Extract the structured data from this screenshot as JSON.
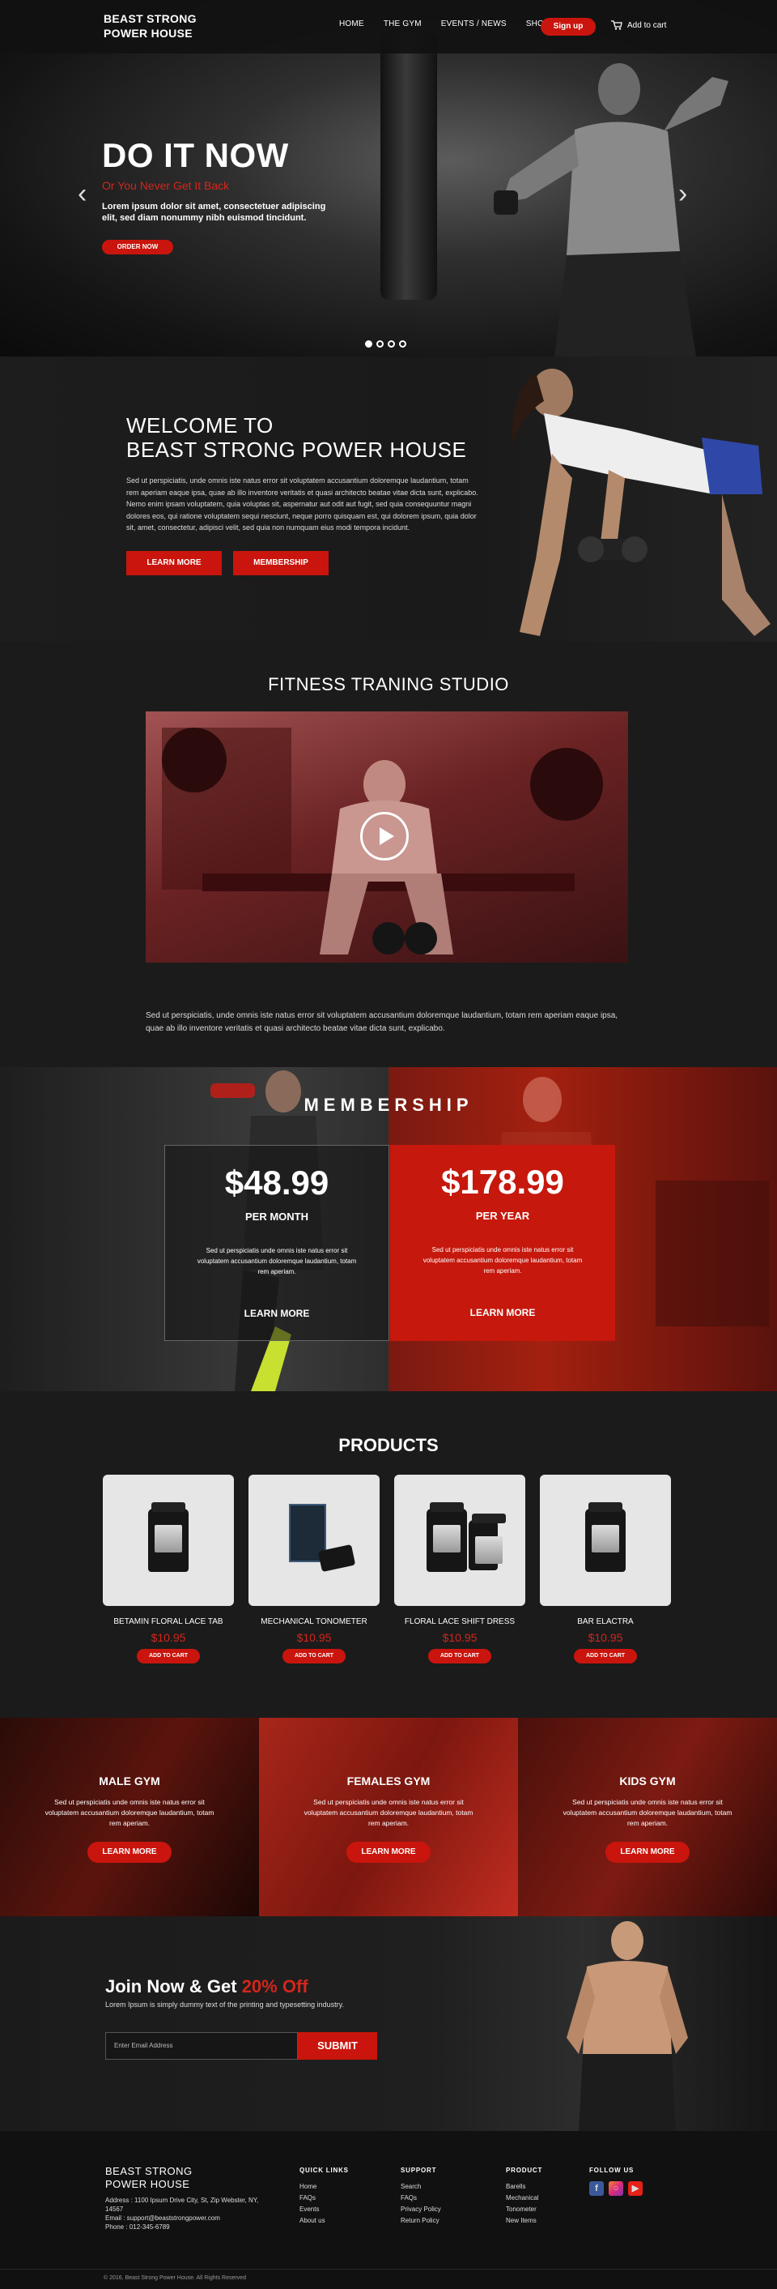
{
  "header": {
    "logo_line1": "BEAST STRONG",
    "logo_line2": "POWER HOUSE",
    "nav": [
      "HOME",
      "THE GYM",
      "EVENTS / NEWS",
      "SHOP"
    ],
    "signup_label": "Sign up",
    "cart_label": "Add to cart"
  },
  "hero": {
    "title": "DO IT NOW",
    "subtitle": "Or You Never Get It Back",
    "text": "Lorem ipsum dolor sit amet, consectetuer adipiscing elit, sed diam nonummy nibh euismod tincidunt.",
    "button": "ORDER NOW",
    "slides": 4,
    "active_slide": 1
  },
  "welcome": {
    "title_line1": "WELCOME TO",
    "title_line2": "BEAST STRONG POWER HOUSE",
    "text": "Sed ut perspiciatis, unde omnis iste natus error sit voluptatem accusantium doloremque laudantium, totam rem aperiam eaque ipsa, quae ab illo inventore veritatis et quasi architecto beatae vitae dicta sunt, explicabo. Nemo enim ipsam voluptatem, quia voluptas sit, aspernatur aut odit aut fugit, sed quia consequuntur magni dolores eos, qui ratione voluptatem sequi nesciunt, neque porro quisquam est, qui dolorem ipsum, quia dolor sit, amet, consectetur, adipisci velit, sed quia non numquam eius modi tempora incidunt.",
    "btn_learn": "LEARN MORE",
    "btn_membership": "MEMBERSHIP"
  },
  "fitness": {
    "title": "FITNESS TRANING STUDIO",
    "text": "Sed ut perspiciatis, unde omnis iste natus error sit voluptatem accusantium doloremque laudantium, totam rem aperiam eaque ipsa, quae ab illo inventore veritatis et quasi architecto beatae vitae dicta sunt, explicabo."
  },
  "membership": {
    "title": "MEMBERSHIP",
    "plans": [
      {
        "price": "$48.99",
        "period": "PER MONTH",
        "desc": "Sed ut perspiciatis unde omnis iste natus error sit voluptatem accusantium doloremque laudantium, totam rem aperiam.",
        "link": "LEARN MORE"
      },
      {
        "price": "$178.99",
        "period": "PER YEAR",
        "desc": "Sed ut perspiciatis unde omnis iste natus error sit voluptatem accusantium doloremque laudantium, totam rem aperiam.",
        "link": "LEARN MORE"
      }
    ]
  },
  "products": {
    "title": "PRODUCTS",
    "items": [
      {
        "name": "BETAMIN FLORAL LACE TAB",
        "price": "$10.95",
        "button": "ADD TO CART"
      },
      {
        "name": "MECHANICAL TONOMETER",
        "price": "$10.95",
        "button": "ADD TO CART"
      },
      {
        "name": "FLORAL LACE SHIFT DRESS",
        "price": "$10.95",
        "button": "ADD TO CART"
      },
      {
        "name": "BAR ELACTRA",
        "price": "$10.95",
        "button": "ADD TO CART"
      }
    ]
  },
  "gyms": [
    {
      "title": "MALE GYM",
      "desc": "Sed ut perspiciatis unde omnis iste natus error sit voluptatem accusantium doloremque laudantium, totam rem aperiam.",
      "button": "LEARN MORE"
    },
    {
      "title": "FEMALES GYM",
      "desc": "Sed ut perspiciatis unde omnis iste natus error sit voluptatem accusantium doloremque laudantium, totam rem aperiam.",
      "button": "LEARN MORE"
    },
    {
      "title": "KIDS GYM",
      "desc": "Sed ut perspiciatis unde omnis iste natus error sit voluptatem accusantium doloremque laudantium, totam rem aperiam.",
      "button": "LEARN MORE"
    }
  ],
  "join": {
    "title_start": "Join Now & Get ",
    "title_highlight": "20% Off",
    "text": "Lorem Ipsum is simply dummy text of the printing and typesetting industry.",
    "email_placeholder": "Enter Email Address",
    "submit": "SUBMIT"
  },
  "footer": {
    "logo_line1": "BEAST STRONG",
    "logo_line2": "POWER HOUSE",
    "address": "Address : 1100 Ipsum Drive City, St, Zip Webster, NY, 14567",
    "email": "Email : support@beaststrongpower.com",
    "phone": "Phone : 012-345-6789",
    "columns": [
      {
        "heading": "QUICK LINKS",
        "links": [
          "Home",
          "FAQs",
          "Events",
          "About us"
        ]
      },
      {
        "heading": "SUPPORT",
        "links": [
          "Search",
          "FAQs",
          "Privacy Policy",
          "Return Policy"
        ]
      },
      {
        "heading": "PRODUCT",
        "links": [
          "Barells",
          "Mechanical",
          "Tonometer",
          "New Items"
        ]
      }
    ],
    "follow_heading": "FOLLOW US",
    "social_icons": [
      "facebook-icon",
      "instagram-icon",
      "youtube-icon"
    ],
    "copyright": "© 2016, Beast Strong Power House. All Rights Reserved"
  },
  "colors": {
    "accent": "#c9150d",
    "dark": "#1a1a1a"
  }
}
